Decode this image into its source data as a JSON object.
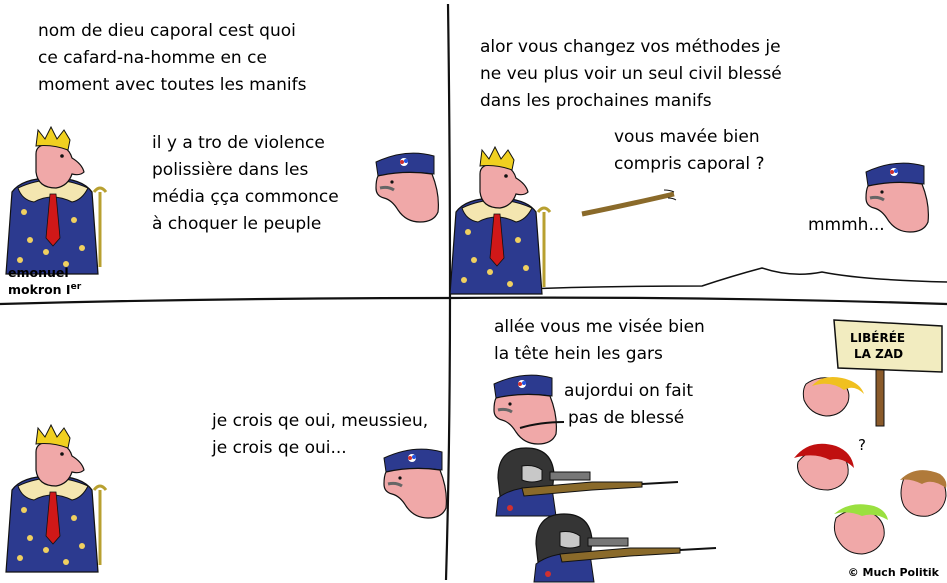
{
  "panel1": {
    "lines": [
      "nom de dieu caporal cest quoi",
      "ce cafard-na-homme en ce",
      "moment avec toutes les manifs"
    ],
    "reply": [
      "il y a tro de violence",
      "polissière dans les",
      "média çça commonce",
      "à choquer le peuple"
    ],
    "king_caption": [
      "emonuel",
      "mokron I"
    ],
    "king_caption_sup": "er"
  },
  "panel2": {
    "lines": [
      "alor vous changez vos méthodes je",
      "ne veu plus voir un seul civil blessé",
      "dans les prochaines manifs"
    ],
    "question": [
      "vous mavée bien",
      "compris caporal ?"
    ],
    "reply": "mmmh..."
  },
  "panel3": {
    "reply": [
      "je crois qe oui, meussieu,",
      "je crois qe oui..."
    ]
  },
  "panel4": {
    "order": [
      "allée vous me visée bien",
      "la tête hein les gars"
    ],
    "note": [
      "aujordui on fait",
      "pas de blessé"
    ],
    "sign": [
      "LIBÉRÉE",
      "LA ZAD"
    ],
    "question_mark": "?"
  },
  "credit": "© Much Politik",
  "colors": {
    "robe": "#2c3a8f",
    "skin": "#f0a8a8",
    "crown": "#f0d020",
    "tie": "#d01818",
    "cap": "#2c3a8f",
    "rifle": "#8a6a2a"
  }
}
